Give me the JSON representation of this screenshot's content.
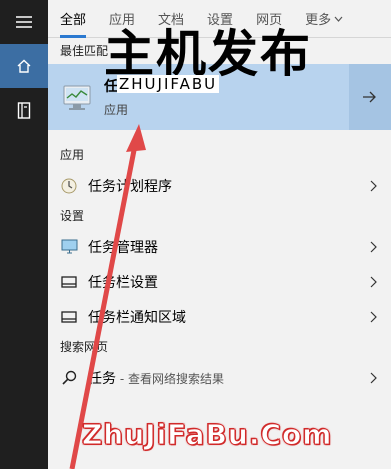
{
  "tabs": [
    "全部",
    "应用",
    "文档",
    "设置",
    "网页",
    "更多"
  ],
  "best_match": {
    "section": "最佳匹配",
    "name": "任务管理器",
    "subtitle": "应用"
  },
  "apps": {
    "section": "应用",
    "items": [
      {
        "label": "任务计划程序"
      }
    ]
  },
  "settings": {
    "section": "设置",
    "items": [
      {
        "label": "任务管理器"
      },
      {
        "label": "任务栏设置"
      },
      {
        "label": "任务栏通知区域"
      }
    ]
  },
  "web": {
    "section": "搜索网页",
    "query": "任务",
    "hint": " - 查看网络搜索结果"
  },
  "watermark": {
    "big": "主机发布",
    "small": "ZHUJIFABU",
    "url": "ZhuJiFaBu.Com"
  },
  "colors": {
    "accent": "#2b79d0",
    "selected_bg": "#b8d3ee",
    "arrow": "#e04848"
  }
}
